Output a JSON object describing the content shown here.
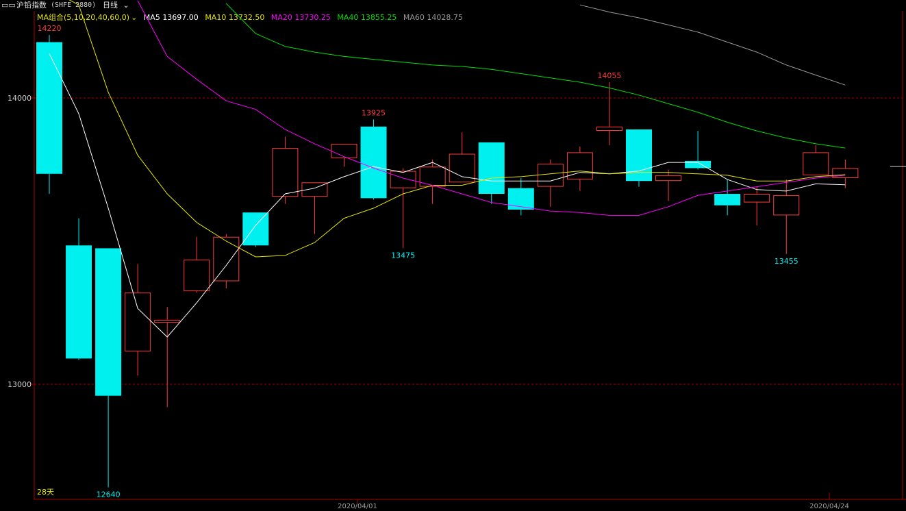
{
  "header": {
    "instrument_name": "沪铅指数",
    "instrument_code": "(SHFE 2880)",
    "period_label": "日线",
    "ma_combo_label": "MA组合(5,10,20,40,60,0)",
    "ma_readouts": [
      {
        "name": "MA5",
        "value": "13697.00",
        "color": "#ffffff"
      },
      {
        "name": "MA10",
        "value": "13732.50",
        "color": "#e8e800"
      },
      {
        "name": "MA20",
        "value": "13730.25",
        "color": "#ff00ff"
      },
      {
        "name": "MA40",
        "value": "13855.25",
        "color": "#00e000"
      },
      {
        "name": "MA60",
        "value": "14028.75",
        "color": "#9a9a9a"
      }
    ]
  },
  "footer": {
    "days_label": "28天",
    "x_date_labels": [
      "2020/04/01",
      "2020/04/24"
    ]
  },
  "colors": {
    "up": "#ff3c3c",
    "down": "#00f0f0",
    "grid": "#b00000",
    "axis": "#b00000"
  },
  "chart_data": {
    "type": "candlestick",
    "y_ticks": [
      14000,
      13000
    ],
    "ylim": [
      12640,
      14400
    ],
    "annotations": [
      {
        "label": "14220",
        "candle": 0,
        "kind": "high",
        "color": "#ff3c3c"
      },
      {
        "label": "12640",
        "candle": 2,
        "kind": "low",
        "color": "#00f0f0"
      },
      {
        "label": "13925",
        "candle": 11,
        "kind": "high",
        "color": "#ff3c3c"
      },
      {
        "label": "13475",
        "candle": 12,
        "kind": "low",
        "color": "#00f0f0"
      },
      {
        "label": "14055",
        "candle": 19,
        "kind": "high",
        "color": "#ff3c3c"
      },
      {
        "label": "13455",
        "candle": 25,
        "kind": "low",
        "color": "#00f0f0"
      }
    ],
    "candles": [
      {
        "open": 14195,
        "high": 14220,
        "low": 13665,
        "close": 13735
      },
      {
        "open": 13485,
        "high": 13580,
        "low": 13085,
        "close": 13090
      },
      {
        "open": 13475,
        "high": 13475,
        "low": 12640,
        "close": 12960
      },
      {
        "open": 13115,
        "high": 13420,
        "low": 13030,
        "close": 13320
      },
      {
        "open": 13215,
        "high": 13270,
        "low": 12920,
        "close": 13225
      },
      {
        "open": 13325,
        "high": 13515,
        "low": 13320,
        "close": 13435
      },
      {
        "open": 13360,
        "high": 13525,
        "low": 13335,
        "close": 13515
      },
      {
        "open": 13600,
        "high": 13600,
        "low": 13480,
        "close": 13485
      },
      {
        "open": 13655,
        "high": 13865,
        "low": 13630,
        "close": 13825
      },
      {
        "open": 13655,
        "high": 13705,
        "low": 13525,
        "close": 13705
      },
      {
        "open": 13790,
        "high": 13835,
        "low": 13760,
        "close": 13840
      },
      {
        "open": 13900,
        "high": 13925,
        "low": 13645,
        "close": 13650
      },
      {
        "open": 13685,
        "high": 13755,
        "low": 13475,
        "close": 13745
      },
      {
        "open": 13690,
        "high": 13785,
        "low": 13630,
        "close": 13760
      },
      {
        "open": 13705,
        "high": 13880,
        "low": 13705,
        "close": 13805
      },
      {
        "open": 13845,
        "high": 13845,
        "low": 13630,
        "close": 13665
      },
      {
        "open": 13685,
        "high": 13720,
        "low": 13590,
        "close": 13610
      },
      {
        "open": 13690,
        "high": 13785,
        "low": 13620,
        "close": 13770
      },
      {
        "open": 13715,
        "high": 13830,
        "low": 13675,
        "close": 13810
      },
      {
        "open": 13885,
        "high": 14055,
        "low": 13835,
        "close": 13900
      },
      {
        "open": 13890,
        "high": 13890,
        "low": 13690,
        "close": 13710
      },
      {
        "open": 13710,
        "high": 13750,
        "low": 13640,
        "close": 13730
      },
      {
        "open": 13780,
        "high": 13885,
        "low": 13750,
        "close": 13755
      },
      {
        "open": 13665,
        "high": 13715,
        "low": 13590,
        "close": 13625
      },
      {
        "open": 13635,
        "high": 13690,
        "low": 13555,
        "close": 13665
      },
      {
        "open": 13590,
        "high": 13715,
        "low": 13455,
        "close": 13660
      },
      {
        "open": 13730,
        "high": 13835,
        "low": 13730,
        "close": 13810
      },
      {
        "open": 13720,
        "high": 13785,
        "low": 13685,
        "close": 13755
      }
    ],
    "ma_series": [
      {
        "name": "MA5",
        "color": "#ffffff",
        "values": [
          14155,
          13945,
          13615,
          13265,
          13165,
          13285,
          13415,
          13555,
          13665,
          13685,
          13725,
          13760,
          13740,
          13775,
          13725,
          13710,
          13710,
          13710,
          13740,
          13735,
          13745,
          13775,
          13775,
          13715,
          13680,
          13675,
          13700,
          13697
        ]
      },
      {
        "name": "MA10",
        "color": "#e8e800",
        "values": [
          14380,
          14325,
          14020,
          13800,
          13665,
          13565,
          13500,
          13445,
          13450,
          13495,
          13580,
          13615,
          13665,
          13695,
          13695,
          13720,
          13725,
          13735,
          13745,
          13735,
          13740,
          13740,
          13735,
          13730,
          13710,
          13710,
          13725,
          13732
        ]
      },
      {
        "name": "MA20",
        "color": "#ff00ff",
        "values": [
          null,
          null,
          null,
          14340,
          14145,
          14065,
          13990,
          13960,
          13890,
          13840,
          13795,
          13755,
          13720,
          13695,
          13665,
          13635,
          13620,
          13605,
          13600,
          13590,
          13590,
          13620,
          13660,
          13675,
          13690,
          13705,
          13720,
          13730
        ]
      },
      {
        "name": "MA40",
        "color": "#00e000",
        "values": [
          null,
          null,
          null,
          null,
          null,
          null,
          14330,
          14225,
          14180,
          14160,
          14145,
          14135,
          14125,
          14115,
          14110,
          14100,
          14085,
          14070,
          14055,
          14035,
          14010,
          13980,
          13950,
          13915,
          13885,
          13860,
          13840,
          13825
        ]
      },
      {
        "name": "MA60",
        "color": "#9a9a9a",
        "values": [
          null,
          null,
          null,
          null,
          null,
          null,
          null,
          null,
          null,
          null,
          null,
          null,
          null,
          null,
          null,
          null,
          null,
          null,
          14325,
          14300,
          14280,
          14255,
          14230,
          14195,
          14160,
          14115,
          14080,
          14045
        ]
      }
    ]
  }
}
